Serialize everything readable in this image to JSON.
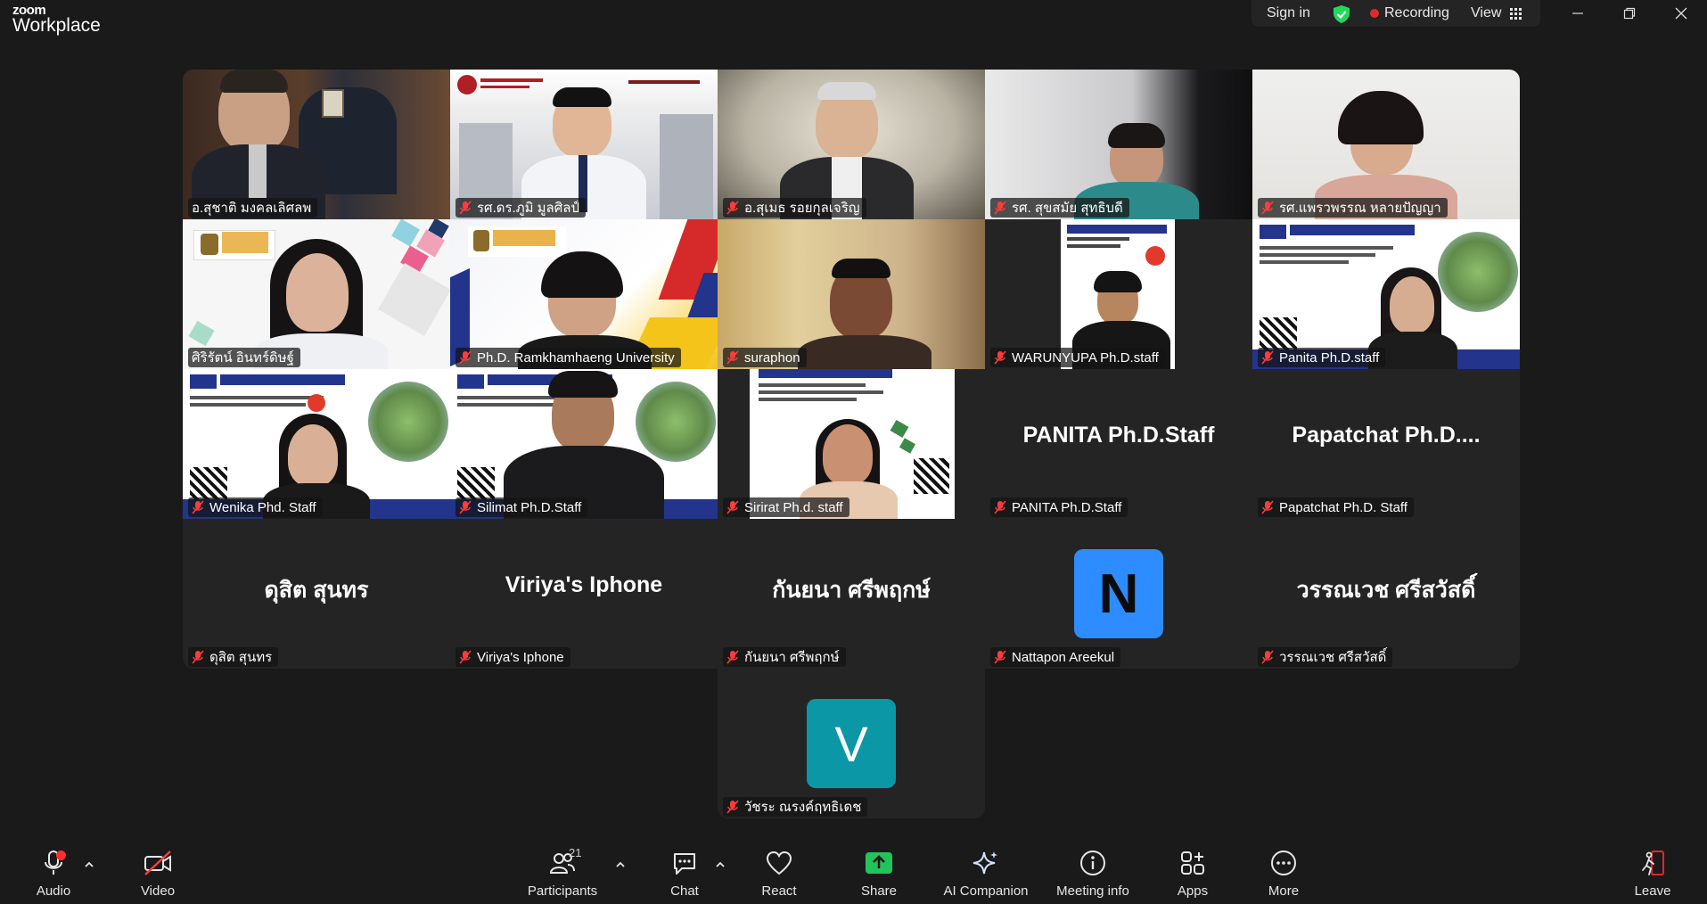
{
  "app": {
    "logo_top": "zoom",
    "logo_bottom": "Workplace"
  },
  "titlebar": {
    "sign_in": "Sign in",
    "recording": "Recording",
    "view": "View",
    "accent_green": "#23d959",
    "record_red": "#e0292b"
  },
  "participants": [
    {
      "name": "อ.สุชาติ มงคลเลิศลพ",
      "muted": false
    },
    {
      "name": "รศ.ดร.ภูมิ มูลศิลป์",
      "muted": true
    },
    {
      "name": "อ.สุเมธ รอยกุลเจริญ",
      "muted": true
    },
    {
      "name": "รศ. สุขสมัย สุทธิบดี",
      "muted": true
    },
    {
      "name": "รศ.แพรวพรรณ หลายปัญญา",
      "muted": true
    },
    {
      "name": "ศิริรัตน์ อินทร์ดิษฐ์",
      "muted": false,
      "active": true
    },
    {
      "name": "Ph.D. Ramkhamhaeng University",
      "muted": true
    },
    {
      "name": "suraphon",
      "muted": true
    },
    {
      "name": "WARUNYUPA Ph.D.staff",
      "muted": true
    },
    {
      "name": "Panita Ph.D.staff",
      "muted": true
    },
    {
      "name": "Wenika Phd. Staff",
      "muted": true
    },
    {
      "name": "Silimat Ph.D.Staff",
      "muted": true
    },
    {
      "name": "Sirirat Ph.d. staff",
      "muted": true
    },
    {
      "name": "PANITA Ph.D.Staff",
      "muted": true,
      "display": "PANITA Ph.D.Staff"
    },
    {
      "name": "Papatchat Ph.D. Staff",
      "muted": true,
      "display": "Papatchat  Ph.D...."
    },
    {
      "name": "ดุสิต  สุนทร",
      "muted": true,
      "display": "ดุสิต  สุนทร"
    },
    {
      "name": "Viriya's Iphone",
      "muted": true,
      "display": "Viriya's Iphone"
    },
    {
      "name": "กันยนา ศรีพฤกษ์",
      "muted": true,
      "display": "กันยนา ศรีพฤกษ์"
    },
    {
      "name": "Nattapon Areekul",
      "muted": true,
      "avatar_letter": "N",
      "avatar_color": "#2d8cff"
    },
    {
      "name": "วรรณเวช ศรีสวัสดิ์",
      "muted": true,
      "display": "วรรณเวช ศรีสวัสดิ์"
    },
    {
      "name": "วัชระ ณรงค์ฤทธิเดช",
      "muted": true,
      "avatar_letter": "V",
      "avatar_color": "#0b97a6"
    }
  ],
  "toolbar": {
    "audio": "Audio",
    "video": "Video",
    "participants": "Participants",
    "participants_count": "21",
    "chat": "Chat",
    "react": "React",
    "share": "Share",
    "ai_companion": "AI Companion",
    "meeting_info": "Meeting info",
    "apps": "Apps",
    "more": "More",
    "leave": "Leave",
    "share_color": "#23c35b",
    "leave_color": "#e02828"
  }
}
